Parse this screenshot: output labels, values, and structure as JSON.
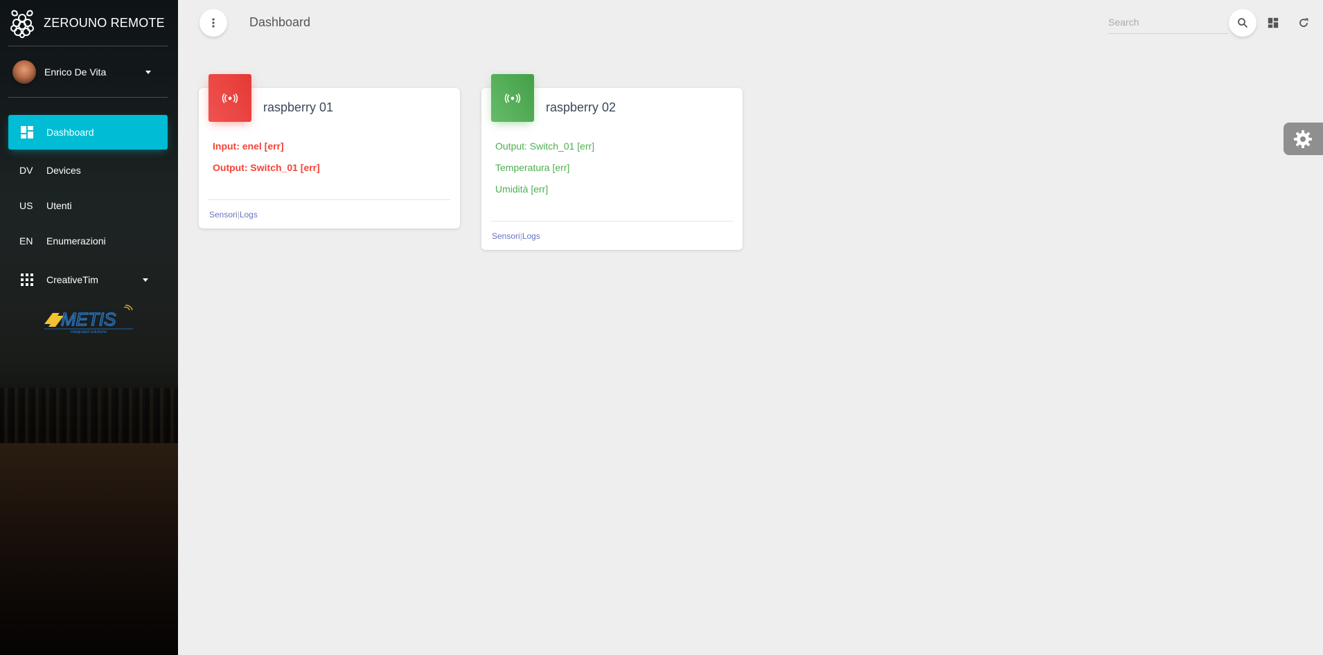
{
  "app": {
    "title": "ZEROUNO REMOTE"
  },
  "user": {
    "name": "Enrico De Vita"
  },
  "sidebar": {
    "items": [
      {
        "label": "Dashboard",
        "icon": "dashboard-icon",
        "active": true
      },
      {
        "mini": "DV",
        "label": "Devices"
      },
      {
        "mini": "US",
        "label": "Utenti"
      },
      {
        "mini": "EN",
        "label": "Enumerazioni"
      },
      {
        "label": "CreativeTim",
        "icon": "apps-grid-icon",
        "expandable": true
      }
    ],
    "logo": {
      "name": "METIS",
      "subtitle": "integrated solutions"
    }
  },
  "header": {
    "title": "Dashboard",
    "search_placeholder": "Search",
    "icons": [
      "more-vert-icon",
      "search-icon",
      "dashboard-icon",
      "refresh-icon"
    ]
  },
  "devices": [
    {
      "title": "raspberry 01",
      "status_color": "#f44336",
      "lines": [
        "Input: enel [err]",
        "Output: Switch_01 [err]"
      ],
      "links": {
        "sensori": "Sensori",
        "separator": "|",
        "logs": "Logs"
      }
    },
    {
      "title": "raspberry 02",
      "status_color": "#4caf50",
      "lines": [
        "Output: Switch_01 [err]",
        "Temperatura [err]",
        "Umidità [err]"
      ],
      "links": {
        "sensori": "Sensori",
        "separator": "|",
        "logs": "Logs"
      }
    }
  ],
  "colors": {
    "accent": "#00bcd4",
    "error": "#f44336",
    "ok": "#4caf50",
    "link": "#3f51b5"
  }
}
